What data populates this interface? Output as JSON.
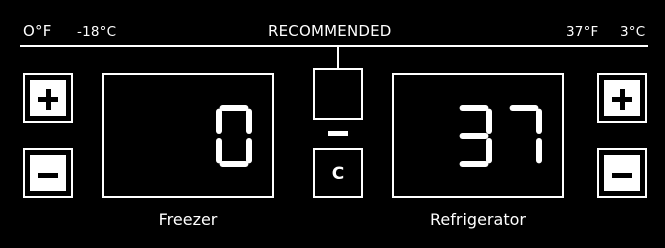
{
  "header": {
    "left_f": "O°F",
    "left_c": "-18°C",
    "center": "RECOMMENDED",
    "right_f": "37°F",
    "right_c": "3°C"
  },
  "freezer": {
    "temperature": "0",
    "label": "Freezer",
    "increase_icon": "plus-icon",
    "decrease_icon": "minus-icon"
  },
  "refrigerator": {
    "temperature": "37",
    "label": "Refrigerator",
    "increase_icon": "plus-icon",
    "decrease_icon": "minus-icon"
  },
  "center": {
    "unit_label": "C"
  },
  "colors": {
    "background": "#000000",
    "foreground": "#ffffff"
  }
}
